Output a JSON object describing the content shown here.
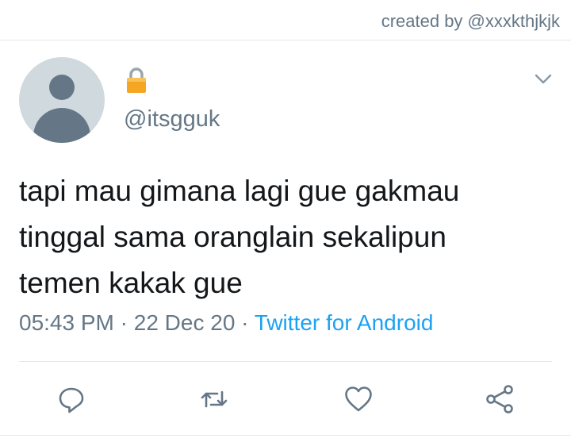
{
  "credit": "created by @xxxkthjkjk",
  "tweet": {
    "handle": "@itsgguk",
    "protected_icon": "lock-icon",
    "lines": [
      "tapi mau gimana lagi gue gakmau",
      "tinggal sama oranglain sekalipun",
      "temen kakak gue"
    ],
    "time": "05:43 PM",
    "separator1": " · ",
    "date": "22 Dec 20",
    "separator2": " · ",
    "source": "Twitter for Android"
  },
  "actions": {
    "reply_icon": "reply-icon",
    "retweet_icon": "retweet-icon",
    "like_icon": "heart-icon",
    "share_icon": "share-icon"
  },
  "colors": {
    "text": "#14171a",
    "secondary": "#657786",
    "accent": "#1da1f2",
    "divider": "#e1e8ed",
    "lock": "#f5a623"
  }
}
